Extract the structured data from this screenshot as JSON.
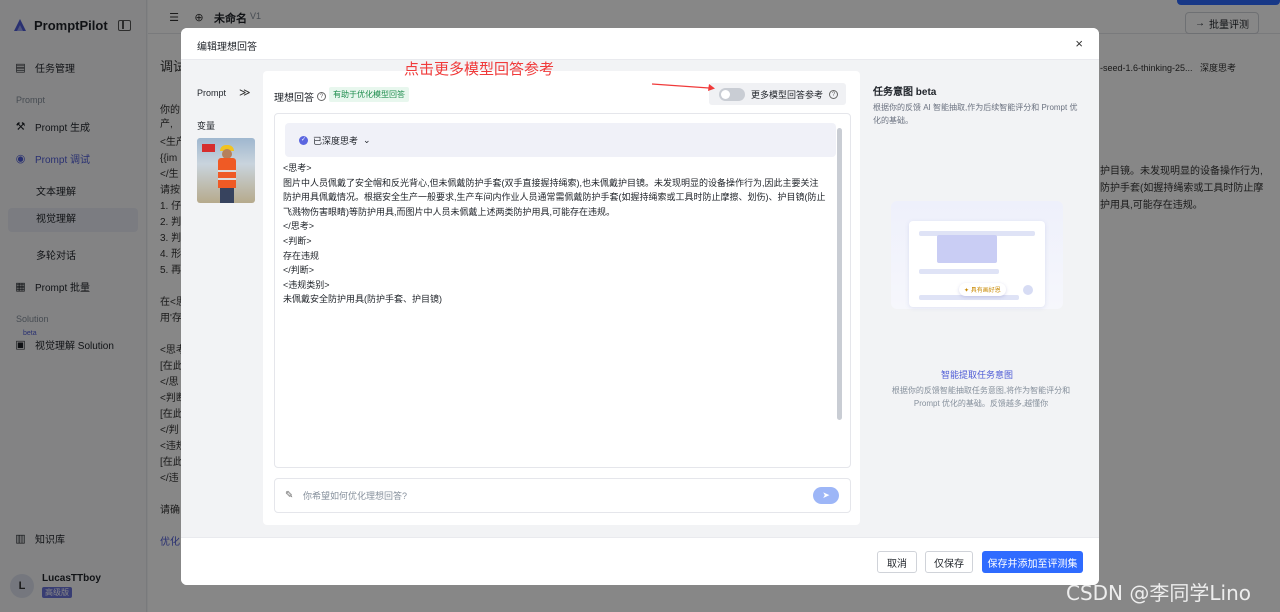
{
  "app": {
    "name": "PromptPilot",
    "sidebar": {
      "task_mgmt": "任务管理",
      "section_prompt": "Prompt",
      "prompt_gen": "Prompt 生成",
      "prompt_debug": "Prompt 调试",
      "text_understand": "文本理解",
      "visual_understand": "视觉理解",
      "multi_turn": "多轮对话",
      "prompt_batch": "Prompt 批量",
      "section_solution": "Solution",
      "beta": "beta",
      "visual_solution": "视觉理解 Solution",
      "knowledge": "知识库",
      "user_initial": "L",
      "user_name": "LucasTTboy",
      "user_badge": "高级版"
    },
    "topbar": {
      "doc_name": "未命名",
      "version": "V1",
      "batch_eval": "批量评测"
    },
    "background": {
      "page_title": "调试",
      "model_name": "-seed-1.6-thinking-25...",
      "deep_think": "深度思考",
      "right_line1": "护目镜。未发现明显的设备操作行为,",
      "right_line2": "防护手套(如握持绳索或工具时防止摩",
      "right_line3": "护用具,可能存在违规。",
      "left_lines": [
        "你的",
        "产,",
        "<生产",
        "{{im",
        "</生",
        "请按",
        "1. 仔",
        "2. 判",
        "3. 判",
        "4. 形",
        "5. 再",
        "在<思",
        "用'存",
        "<思考",
        "[在此",
        "</思",
        "<判断",
        "[在此",
        "</判",
        "<违规",
        "[在此",
        "</违",
        "请确",
        "优化"
      ]
    }
  },
  "modal": {
    "title": "编辑理想回答",
    "close": "×",
    "left": {
      "prompt_label": "Prompt",
      "expand": "≫",
      "var_label": "变量"
    },
    "main": {
      "title": "理想回答",
      "badge": "有助于优化模型回答",
      "toggle_label": "更多模型回答参考",
      "think_label": "已深度思考",
      "answer_lines": [
        "<思考>",
        "图片中人员佩戴了安全帽和反光背心,但未佩戴防护手套(双手直接握持绳索),也未佩戴护目镜。未发现明显的设备操作行为,因此主要关注",
        "防护用具佩戴情况。根据安全生产一般要求,生产车间内作业人员通常需佩戴防护手套(如握持绳索或工具时防止摩擦、划伤)、护目镜(防止",
        "飞溅物伤害眼睛)等防护用具,而图片中人员未佩戴上述两类防护用具,可能存在违规。",
        "</思考>",
        "<判断>",
        "存在违规",
        "</判断>",
        "<违规类别>",
        "未佩戴安全防护用具(防护手套、护目镜)"
      ],
      "input_placeholder": "你希望如何优化理想回答?",
      "input_value": ""
    },
    "annotation": "点击更多模型回答参考",
    "right": {
      "title": "任务意图 beta",
      "desc": "根据你的反馈 AI 智能抽取,作为后续智能评分和 Prompt 优化的基础。",
      "chip": "✦ 具有画好恩",
      "link": "智能提取任务意图",
      "note": "根据你的反馈智能抽取任务意图,将作为智能评分和 Prompt 优化的基础。反馈越多,越懂你"
    },
    "footer": {
      "cancel": "取消",
      "save_only": "仅保存",
      "save_add": "保存并添加至评测集"
    }
  },
  "watermark": "CSDN @李同学Lino",
  "colors": {
    "primary": "#2f6bff",
    "accent": "#4e5bd6",
    "annotation": "#f03a3a",
    "badge_green": "#1c8c4c"
  }
}
